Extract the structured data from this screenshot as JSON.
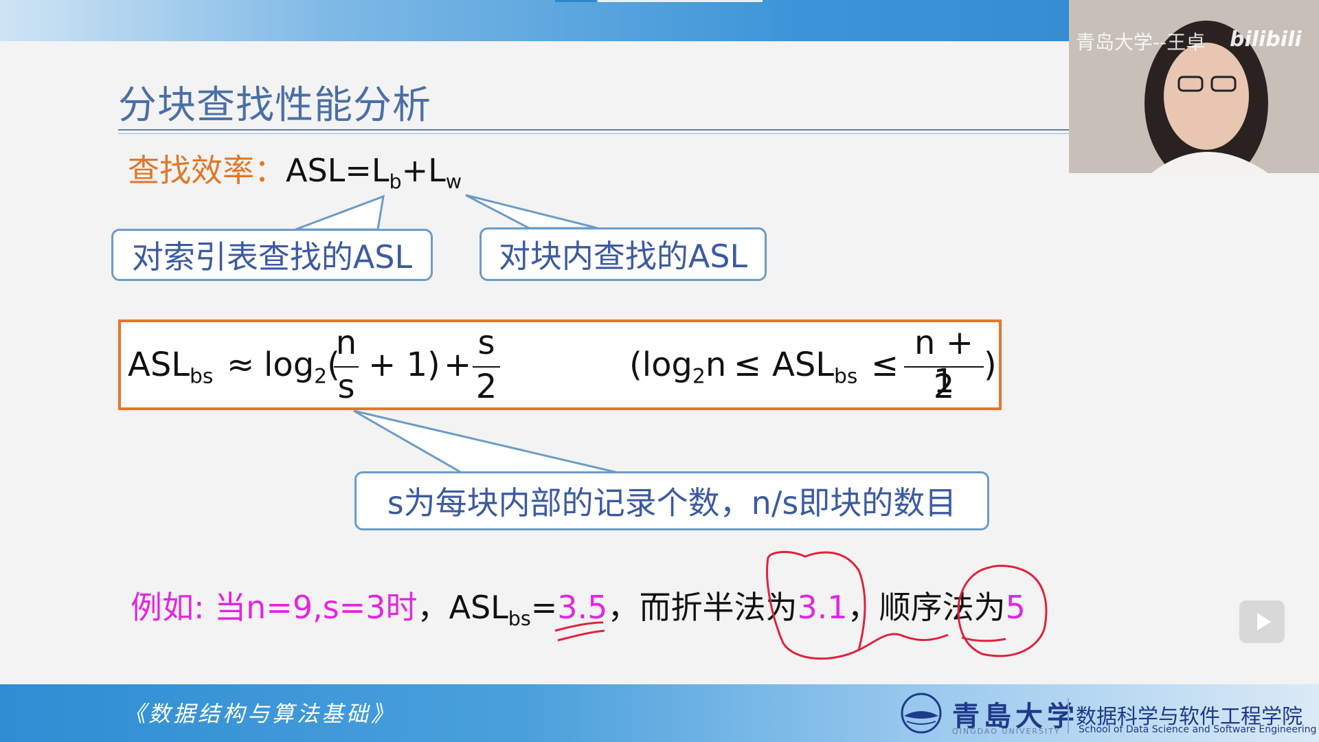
{
  "slide": {
    "title": "分块查找性能分析",
    "efficiency": {
      "label": "查找效率：",
      "formula_main": "ASL=L",
      "sub_b": "b",
      "plus": "+L",
      "sub_w": "w"
    },
    "callouts": {
      "index": "对索引表查找的ASL",
      "block": "对块内查找的ASL",
      "note": "s为每块内部的记录个数，n/s即块的数目"
    },
    "formula": {
      "lhs": "ASL",
      "lhs_sub": "bs",
      "approx": "≈",
      "log": "log",
      "log_sub": "2",
      "open": "(",
      "frac1_num": "n",
      "frac1_den": "s",
      "plus_one": "+ 1)",
      "plus": "+",
      "frac2_num": "s",
      "frac2_den": "2",
      "range_open": "(log",
      "range_log_sub": "2",
      "range_n": "n",
      "le1": "≤",
      "range_asl": "ASL",
      "range_asl_sub": "bs",
      "le2": "≤",
      "frac3_num": "n + 1",
      "frac3_den": "2",
      "range_close": ")"
    },
    "example": {
      "prefix": "例如: 当n=9,s=3时",
      "comma1": "，ASL",
      "asl_sub": "bs",
      "eq": "=",
      "val1": "3.5",
      "mid": "，而折半法为",
      "val2": "3.1",
      "comma2": "，顺序法为",
      "val3": "5"
    }
  },
  "footer": {
    "course": "《数据结构与算法基础》",
    "university": "青島大学",
    "university_en": "QINGDAO UNIVERSITY",
    "school_cn": "数据科学与软件工程学院",
    "school_en": "School of Data Science and Software Engineering"
  },
  "webcam": {
    "caption": "青岛大学--王卓",
    "logo": "bilibili"
  },
  "colors": {
    "title_blue": "#4a6fa6",
    "orange": "#e0782a",
    "magenta": "#e225e2",
    "annotation_red": "#e0213b"
  }
}
